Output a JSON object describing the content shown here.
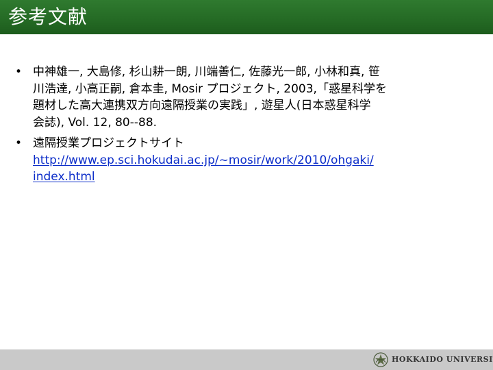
{
  "slide": {
    "title": "参考文献"
  },
  "references": [
    {
      "text": "中神雄一, 大島修, 杉山耕一朗, 川端善仁, 佐藤光一郎, 小林和真, 笹\n川浩達, 小高正嗣, 倉本圭, Mosir プロジェクト, 2003,「惑星科学を\n題材した高大連携双方向遠隔授業の実践」, 遊星人(日本惑星科学\n会誌), Vol. 12, 80--88."
    },
    {
      "text": "遠隔授業プロジェクトサイト",
      "link_line1": "http://www.ep.sci.hokudai.ac.jp/~mosir/work/2010/ohgaki/",
      "link_line2": "index.html"
    }
  ],
  "footer": {
    "institution": "HOKKAIDO UNIVERSITY",
    "logo_icon": "hokkaido-university-emblem"
  }
}
